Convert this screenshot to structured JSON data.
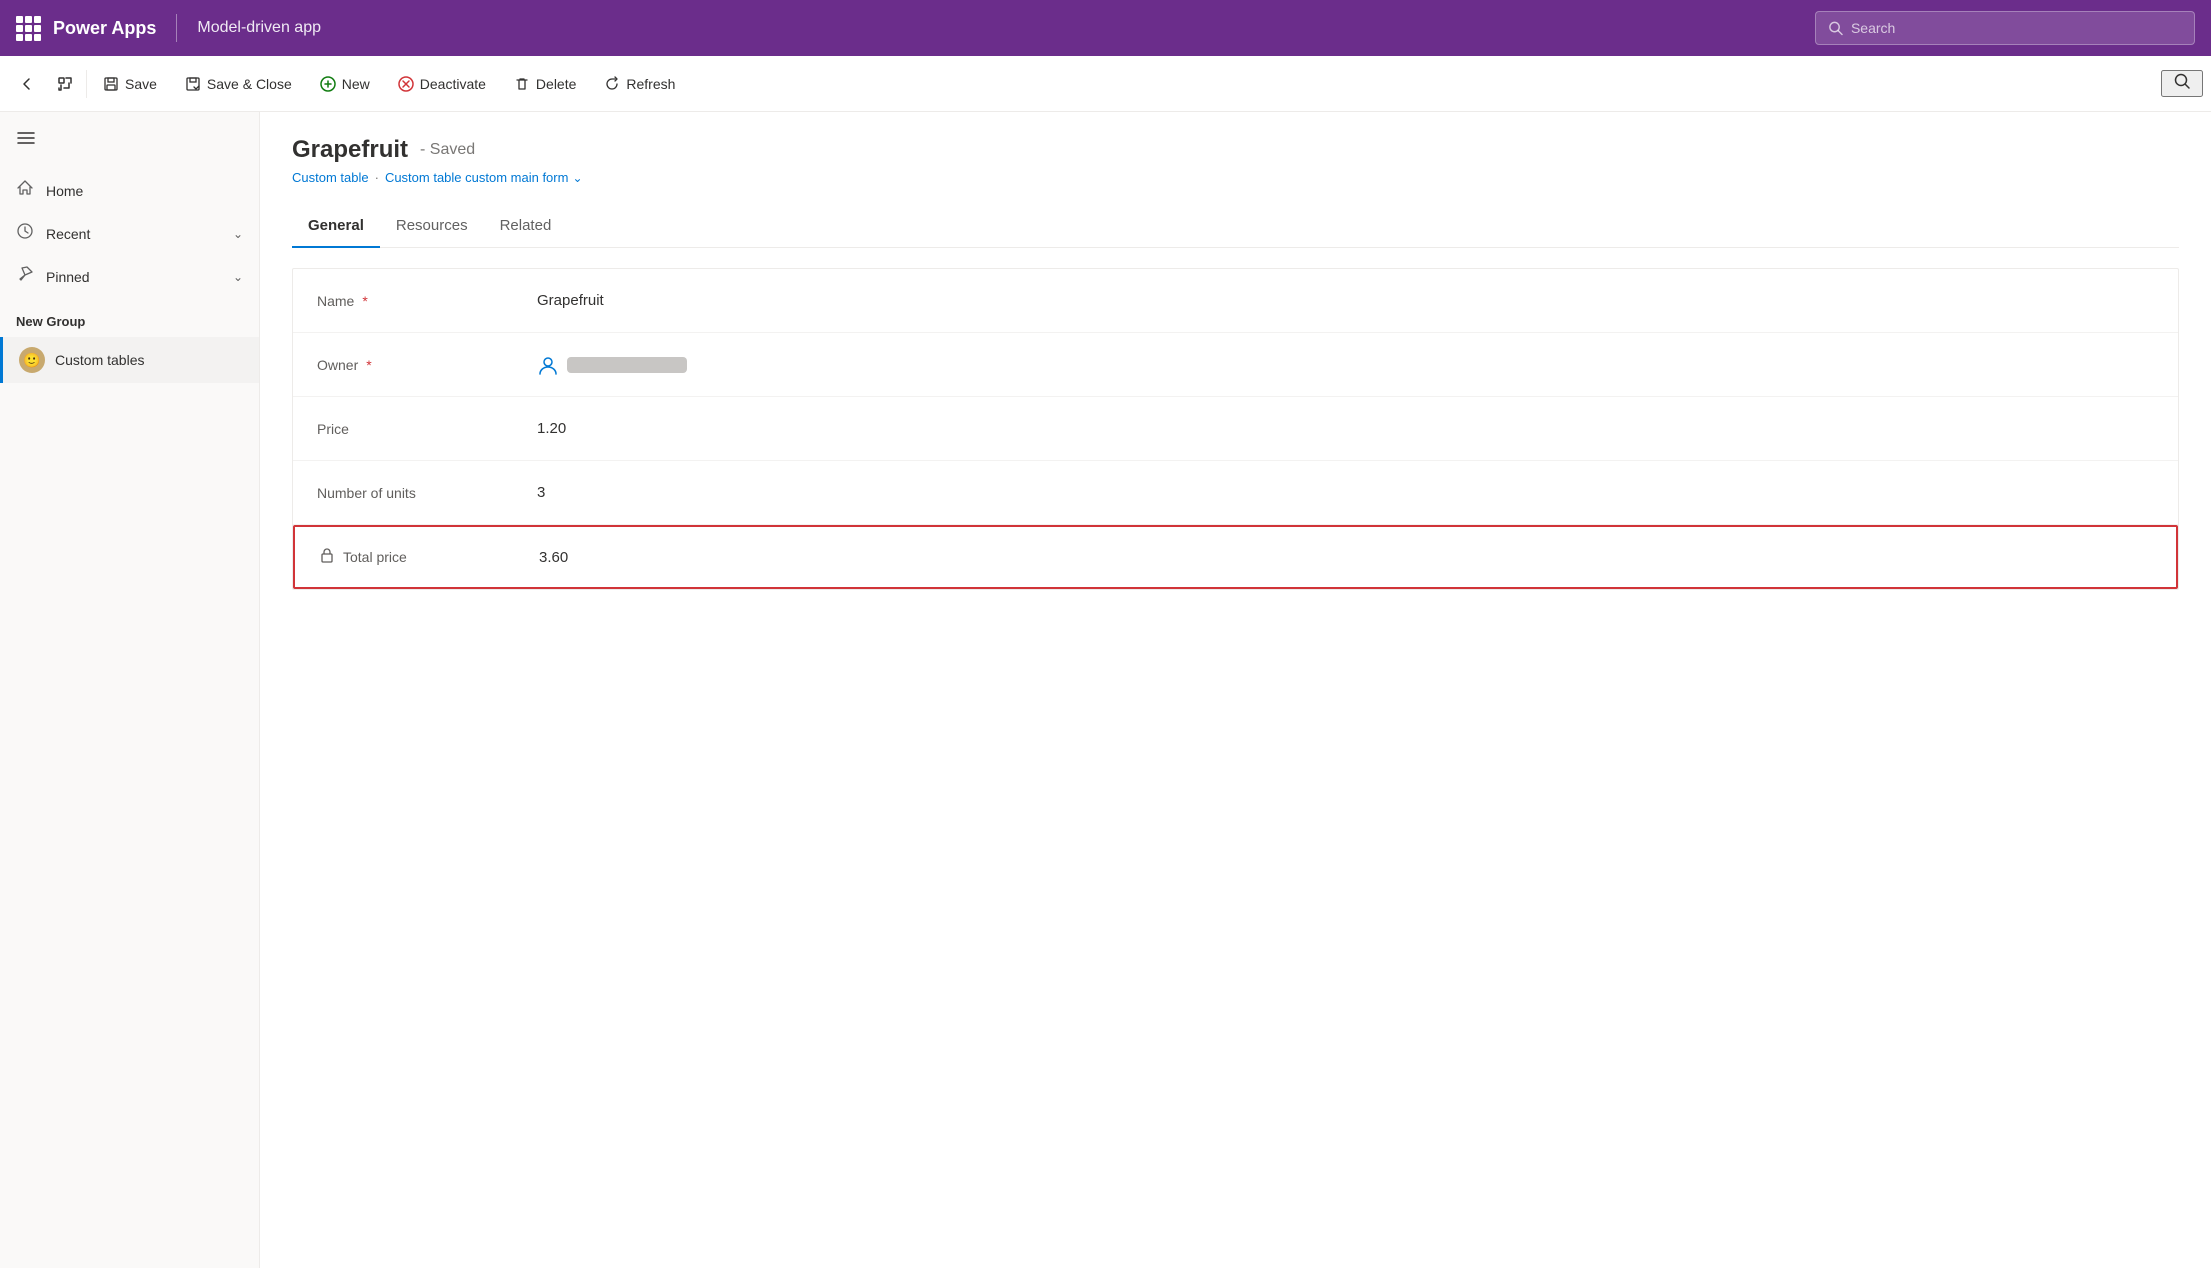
{
  "topbar": {
    "waffle_label": "App launcher",
    "title": "Power Apps",
    "divider": true,
    "app_name": "Model-driven app",
    "search_placeholder": "Search"
  },
  "commandbar": {
    "back_label": "Back",
    "expand_label": "Expand",
    "save_label": "Save",
    "save_close_label": "Save & Close",
    "new_label": "New",
    "deactivate_label": "Deactivate",
    "delete_label": "Delete",
    "refresh_label": "Refresh",
    "search_label": "Search"
  },
  "sidebar": {
    "hamburger_label": "Menu",
    "nav_items": [
      {
        "id": "home",
        "label": "Home",
        "icon": "⌂"
      },
      {
        "id": "recent",
        "label": "Recent",
        "icon": "⏱",
        "chevron": true
      },
      {
        "id": "pinned",
        "label": "Pinned",
        "icon": "✦",
        "chevron": true
      }
    ],
    "group_title": "New Group",
    "list_items": [
      {
        "id": "custom-tables",
        "label": "Custom tables",
        "emoji": "🙂",
        "active": true
      }
    ]
  },
  "record": {
    "title": "Grapefruit",
    "status": "- Saved",
    "breadcrumb_table": "Custom table",
    "breadcrumb_form": "Custom table custom main form",
    "tabs": [
      {
        "id": "general",
        "label": "General",
        "active": true
      },
      {
        "id": "resources",
        "label": "Resources",
        "active": false
      },
      {
        "id": "related",
        "label": "Related",
        "active": false
      }
    ],
    "fields": [
      {
        "id": "name",
        "label": "Name",
        "required": true,
        "value": "Grapefruit",
        "locked": false
      },
      {
        "id": "owner",
        "label": "Owner",
        "required": true,
        "value_type": "owner",
        "locked": false
      },
      {
        "id": "price",
        "label": "Price",
        "required": false,
        "value": "1.20",
        "locked": false
      },
      {
        "id": "units",
        "label": "Number of units",
        "required": false,
        "value": "3",
        "locked": false
      },
      {
        "id": "total_price",
        "label": "Total price",
        "required": false,
        "value": "3.60",
        "locked": true,
        "highlighted": true
      }
    ]
  }
}
